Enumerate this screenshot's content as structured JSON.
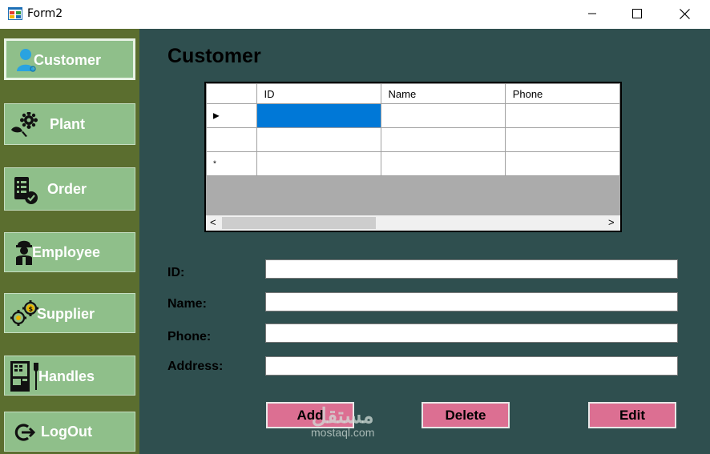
{
  "window": {
    "title": "Form2",
    "controls": [
      "minimize-icon",
      "maximize-icon",
      "close-icon"
    ]
  },
  "sidebar": {
    "items": [
      {
        "label": "Customer",
        "icon": "user-icon",
        "active": true
      },
      {
        "label": "Plant",
        "icon": "flower-gear-icon"
      },
      {
        "label": "Order",
        "icon": "checklist-icon"
      },
      {
        "label": "Employee",
        "icon": "worker-icon"
      },
      {
        "label": "Supplier",
        "icon": "gears-money-icon"
      },
      {
        "label": "Handles",
        "icon": "vending-machine-icon"
      },
      {
        "label": "LogOut",
        "icon": "logout-icon"
      }
    ]
  },
  "main": {
    "title": "Customer",
    "grid": {
      "columns": [
        "ID",
        "Name",
        "Phone"
      ],
      "rows": [
        {
          "marker": "▶",
          "cells": [
            "",
            "",
            ""
          ],
          "selected_col": 0
        },
        {
          "marker": "",
          "cells": [
            "",
            "",
            ""
          ]
        },
        {
          "marker": "*",
          "cells": [
            "",
            "",
            ""
          ]
        }
      ],
      "scroll_left": "<",
      "scroll_right": ">"
    },
    "form": {
      "id_label": "ID:",
      "name_label": "Name:",
      "phone_label": "Phone:",
      "address_label": "Address:",
      "id_value": "",
      "name_value": "",
      "phone_value": "",
      "address_value": ""
    },
    "buttons": {
      "add": "Add",
      "delete": "Delete",
      "edit": "Edit"
    }
  },
  "watermark": {
    "arabic": "مستقل",
    "latin": "mostaql.com"
  },
  "colors": {
    "sidebar_bg": "#5b6e2f",
    "nav_button": "#8fbf8a",
    "main_bg": "#2f4f4f",
    "action_button": "#dc6f92",
    "grid_selection": "#0078d7"
  }
}
